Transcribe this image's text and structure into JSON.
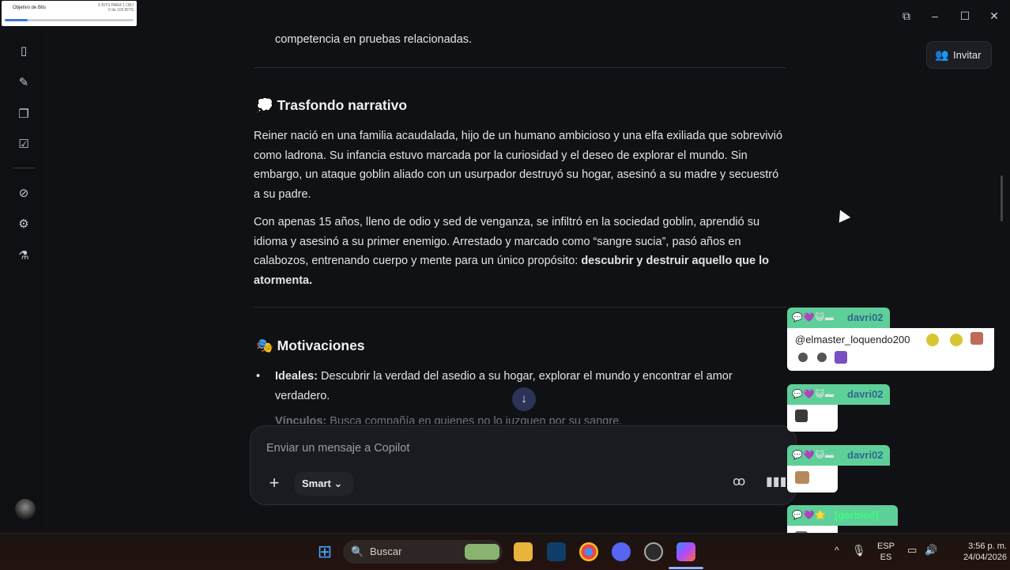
{
  "overlay": {
    "title": "Objetivo de Bits",
    "right_line1": "5 BITS PARA 1 OBJ",
    "right_line2": "0 de 100 BITS",
    "progress": 0.18
  },
  "content": {
    "prev_line": "competencia en pruebas relacionadas.",
    "section1": {
      "emoji": "💭",
      "title": "Trasfondo narrativo",
      "para1": "Reiner nació en una familia acaudalada, hijo de un humano ambicioso y una elfa exiliada que sobrevivió como ladrona. Su infancia estuvo marcada por la curiosidad y el deseo de explorar el mundo. Sin embargo, un ataque goblin aliado con un usurpador destruyó su hogar, asesinó a su madre y secuestró a su padre.",
      "para2_plain": "Con apenas 15 años, lleno de odio y sed de venganza, se infiltró en la sociedad goblin, aprendió su idioma y asesinó a su primer enemigo. Arrestado y marcado como “sangre sucia”, pasó años en calabozos, entrenando cuerpo y mente para un único propósito: ",
      "para2_bold": "descubrir y destruir aquello que lo atormenta."
    },
    "section2": {
      "emoji": "🎭",
      "title": "Motivaciones",
      "items": [
        {
          "label": "Ideales:",
          "text": " Descubrir la verdad del asedio a su hogar, explorar el mundo y encontrar el amor verdadero."
        },
        {
          "label": "Vínculos:",
          "text": " Busca compañía en quienes no lo juzguen por su sangre."
        }
      ]
    }
  },
  "header": {
    "invite_label": "Invitar"
  },
  "composer": {
    "placeholder": "Enviar un mensaje a Copilot",
    "mode_label": "Smart"
  },
  "chat": [
    {
      "user": "davri02",
      "message": "@elmaster_loquendo200"
    },
    {
      "user": "davri02",
      "message": ""
    },
    {
      "user": "davri02",
      "message": ""
    },
    {
      "user": "[garbled]",
      "message": ""
    }
  ],
  "taskbar": {
    "search_label": "Buscar",
    "lang_top": "ESP",
    "lang_bottom": "ES",
    "time": "3:56 p. m.",
    "date": "24/04/2026"
  },
  "colors": {
    "accent": "#3d78d8",
    "chat_head": "#5fcf9a",
    "scroll_btn": "#2c3357"
  },
  "icons": {
    "sidebar": [
      "panel-icon",
      "new-chat-icon",
      "pages-icon",
      "tasks-icon",
      "no-ads-icon",
      "settings-icon",
      "labs-icon"
    ]
  }
}
